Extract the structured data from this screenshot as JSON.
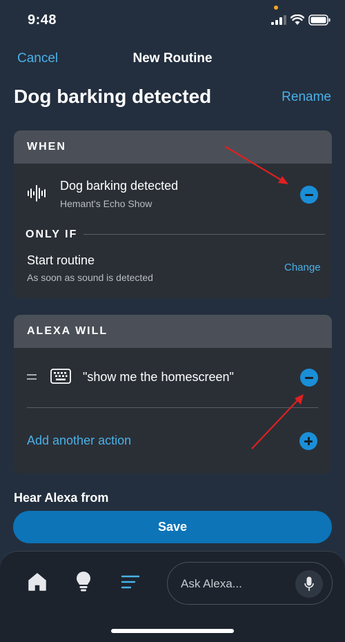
{
  "status_bar": {
    "time": "9:48"
  },
  "nav": {
    "cancel_label": "Cancel",
    "title": "New Routine"
  },
  "routine": {
    "title": "Dog barking detected",
    "rename_label": "Rename"
  },
  "when_section": {
    "header": "WHEN",
    "trigger_title": "Dog barking detected",
    "trigger_device": "Hemant's Echo Show",
    "only_if_label": "ONLY IF",
    "condition_title": "Start routine",
    "condition_detail": "As soon as sound is detected",
    "change_label": "Change"
  },
  "alexa_will_section": {
    "header": "ALEXA WILL",
    "action_text": "\"show me the homescreen\"",
    "add_action_label": "Add another action"
  },
  "hear_alexa_label": "Hear Alexa from",
  "save_label": "Save",
  "bottom_nav": {
    "items": [
      "home-icon",
      "lightbulb-icon",
      "routines-list-icon"
    ],
    "ask_placeholder": "Ask Alexa..."
  },
  "colors": {
    "background": "#232F3E",
    "accent": "#4AB1E8",
    "button": "#0D74B8",
    "annotation_arrow": "#E02020"
  }
}
